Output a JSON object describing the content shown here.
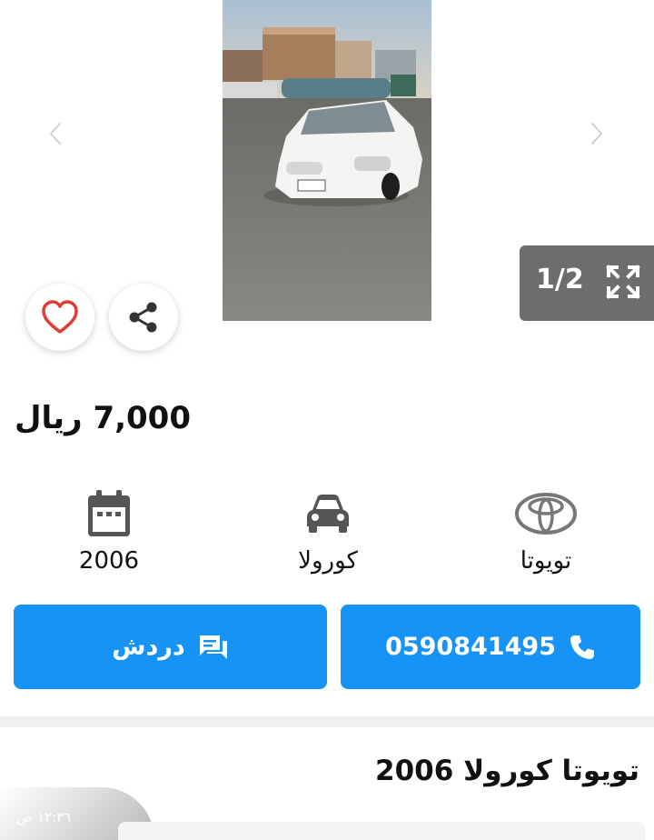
{
  "gallery": {
    "counter": "1/2",
    "prev_icon": "chevron-left-icon",
    "next_icon": "chevron-right-icon",
    "expand_icon": "expand-icon"
  },
  "actions": {
    "favorite_icon": "heart-icon",
    "share_icon": "share-icon"
  },
  "listing": {
    "price": "7,000 ريال",
    "title": "تويوتا كورولا 2006"
  },
  "specs": {
    "year": "2006",
    "model": "كورولا",
    "make": "تويوتا"
  },
  "buttons": {
    "chat_label": "دردش",
    "phone": "0590841495"
  },
  "status": {
    "time": "١٢:٣٦ ص"
  },
  "colors": {
    "accent": "#1793f5",
    "favorite": "#e53935",
    "counter_bg": "#6d6d6d"
  }
}
